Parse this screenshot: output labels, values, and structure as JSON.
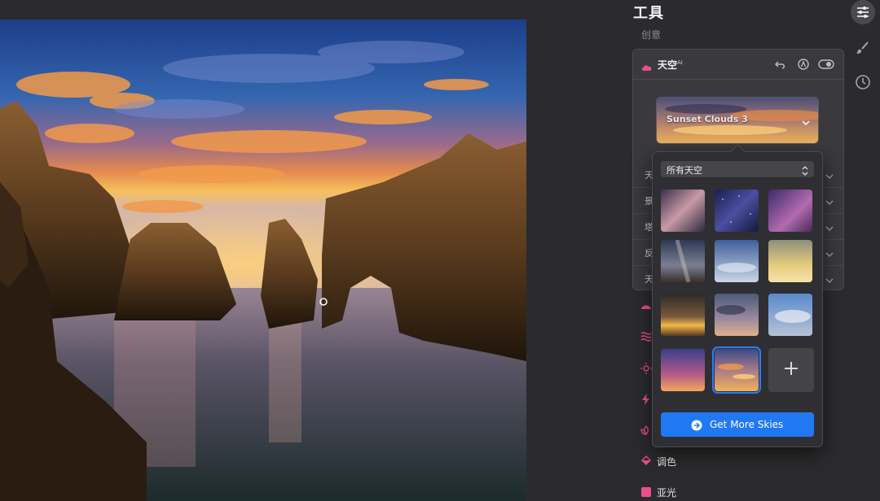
{
  "panel": {
    "title": "工具",
    "section": "创意"
  },
  "sky_tool": {
    "name": "天空",
    "superscript": "AI",
    "preview_label": "Sunset Clouds 3",
    "rows_partial": [
      "天",
      "景",
      "塔",
      "反",
      "天"
    ]
  },
  "popover": {
    "select_value": "所有天空",
    "get_more_label": "Get More Skies",
    "thumbnails": [
      "milky-way-pink",
      "starry-blue",
      "purple-galaxy",
      "milky-way-rocks",
      "blue-clouds",
      "golden-clouds",
      "sunset-dark",
      "dusk-clouds",
      "blue-cumulus",
      "purple-sunset",
      "sunset-clouds-3"
    ],
    "selected_index": 10
  },
  "tools_below": [
    {
      "label": "调色",
      "icon": "paint-bucket-icon",
      "color": "#ec4d8f"
    },
    {
      "label": "亚光",
      "icon": "square-swatch-icon",
      "color": "#ec4d8f"
    }
  ],
  "colors": {
    "accent": "#ec4d8f",
    "button": "#2079f2",
    "panel_bg": "#2b2b2d",
    "card_bg": "#3a3a3e"
  }
}
